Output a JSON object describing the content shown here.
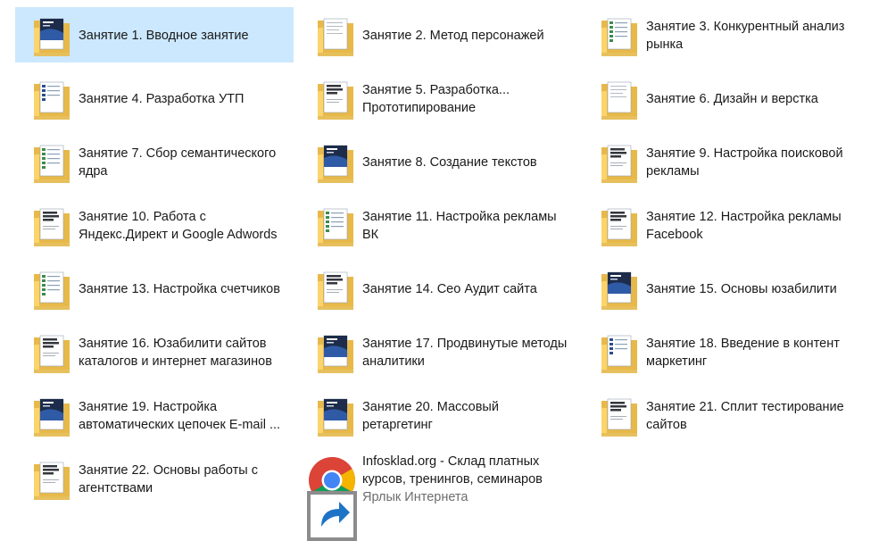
{
  "window": {
    "view": "large-icons-folder-view"
  },
  "folders": [
    {
      "lines": [
        "Занятие 1. Вводное занятие"
      ],
      "cover": "dark",
      "selected": true
    },
    {
      "lines": [
        "Занятие 2. Метод персонажей"
      ],
      "cover": "page"
    },
    {
      "lines": [
        "Занятие 3. Конкурентный анализ",
        "рынка"
      ],
      "cover": "green"
    },
    {
      "lines": [
        "Занятие 4. Разработка УТП"
      ],
      "cover": "blue"
    },
    {
      "lines": [
        "Занятие 5. Разработка...",
        "Прототипирование"
      ],
      "cover": "text"
    },
    {
      "lines": [
        "Занятие 6. Дизайн и верстка"
      ],
      "cover": "page"
    },
    {
      "lines": [
        "Занятие 7. Сбор семантического",
        "ядра"
      ],
      "cover": "green"
    },
    {
      "lines": [
        "Занятие 8. Создание текстов"
      ],
      "cover": "dark"
    },
    {
      "lines": [
        "Занятие 9. Настройка поисковой",
        "рекламы"
      ],
      "cover": "text"
    },
    {
      "lines": [
        "Занятие 10. Работа с",
        "Яндекс.Директ и Google Adwords"
      ],
      "cover": "text"
    },
    {
      "lines": [
        "Занятие 11. Настройка рекламы",
        "ВК"
      ],
      "cover": "green"
    },
    {
      "lines": [
        "Занятие 12. Настройка рекламы",
        "Facebook"
      ],
      "cover": "text"
    },
    {
      "lines": [
        "Занятие 13. Настройка счетчиков"
      ],
      "cover": "green"
    },
    {
      "lines": [
        "Занятие 14. Сео Аудит сайта"
      ],
      "cover": "text"
    },
    {
      "lines": [
        "Занятие 15. Основы юзабилити"
      ],
      "cover": "dark"
    },
    {
      "lines": [
        "Занятие 16. Юзабилити сайтов",
        "каталогов и интернет магазинов"
      ],
      "cover": "text"
    },
    {
      "lines": [
        "Занятие 17. Продвинутые методы",
        "аналитики"
      ],
      "cover": "dark"
    },
    {
      "lines": [
        "Занятие 18. Введение в контент",
        "маркетинг"
      ],
      "cover": "blue"
    },
    {
      "lines": [
        "Занятие 19. Настройка",
        "автоматических цепочек E-mail ..."
      ],
      "cover": "dark"
    },
    {
      "lines": [
        "Занятие 20. Массовый",
        "ретаргетинг"
      ],
      "cover": "dark"
    },
    {
      "lines": [
        "Занятие 21. Сплит тестирование",
        "сайтов"
      ],
      "cover": "text"
    },
    {
      "lines": [
        "Занятие 22. Основы работы с",
        "агентствами"
      ],
      "cover": "text"
    }
  ],
  "shortcut": {
    "lines": [
      "Infosklad.org - Склад платных",
      "курсов, тренингов, семинаров"
    ],
    "type_label": "Ярлык Интернета",
    "icon": "chrome-icon"
  },
  "colors": {
    "selection": "#cce8ff",
    "folder_back": "#e8b949",
    "folder_front": "#fbd46b",
    "text": "#1a1a1a",
    "subtext": "#6d6d6d"
  }
}
